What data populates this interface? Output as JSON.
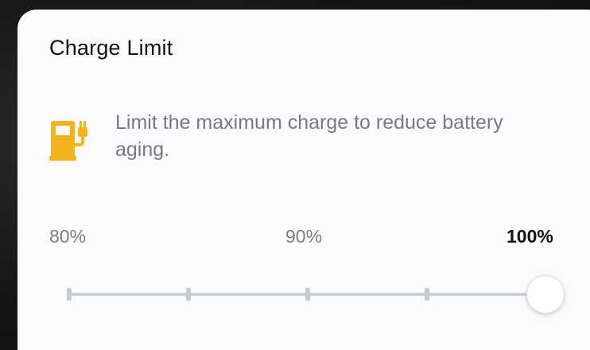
{
  "card": {
    "title": "Charge Limit",
    "icon": "fuel-charger-icon",
    "description": "Limit the maximum charge to reduce battery aging."
  },
  "slider": {
    "labels": [
      "80%",
      "90%",
      "100%"
    ],
    "stops": 5,
    "min": 80,
    "max": 100,
    "value": 100,
    "selected_label": "100%"
  },
  "colors": {
    "accent_icon": "#f2b31c",
    "card_background": "#fbfbfd",
    "track": "#c9d1de",
    "text_primary": "#111111",
    "text_secondary": "#777b80"
  }
}
